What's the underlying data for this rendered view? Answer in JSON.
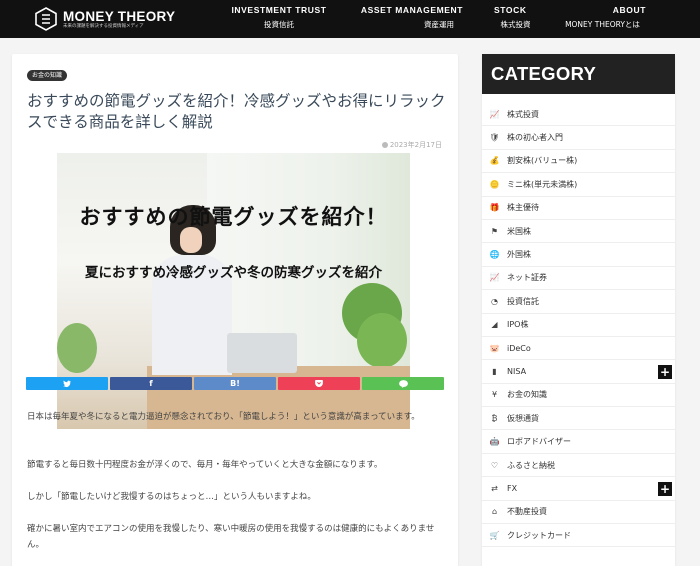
{
  "header": {
    "logo_title": "MONEY THEORY",
    "logo_subtitle": "未来の課題を解決する投資情報メディア",
    "nav": [
      {
        "en": "INVESTMENT TRUST",
        "ja": "投資信託"
      },
      {
        "en": "ASSET MANAGEMENT",
        "ja": "資産運用"
      },
      {
        "en": "STOCK",
        "ja": "株式投資"
      },
      {
        "en": "ABOUT",
        "ja": "MONEY THEORYとは"
      }
    ]
  },
  "article": {
    "category_badge": "お金の知識",
    "title": "おすすめの節電グッズを紹介！冷感グッズやお得にリラックスできる商品を詳しく解説",
    "date": "2023年2月17日",
    "hero_text_main": "おすすめの節電グッズを紹介！",
    "hero_text_sub": "夏におすすめ冷感グッズや冬の防寒グッズを紹介",
    "share": [
      {
        "label": "✓",
        "color": "#1da1f2"
      },
      {
        "label": "f",
        "color": "#3b5998"
      },
      {
        "label": "B!",
        "color": "#5d8ac9"
      },
      {
        "label": "◘",
        "color": "#ee4056"
      },
      {
        "label": "💬",
        "color": "#5ac254"
      }
    ],
    "paragraphs": [
      "日本は毎年夏や冬になると電力逼迫が懸念されており、「節電しよう！」という意識が高まっています。",
      "節電すると毎日数十円程度お金が浮くので、毎月・毎年やっていくと大きな金額になります。",
      "しかし「節電したいけど我慢するのはちょっと…」という人もいますよね。",
      "確かに暑い室内でエアコンの使用を我慢したり、寒い中暖房の使用を我慢するのは健康的にもよくありません。"
    ]
  },
  "sidebar": {
    "heading": "CATEGORY",
    "items": [
      {
        "label": "株式投資",
        "icon": "chart-line-icon",
        "glyph": "📈",
        "plus": false
      },
      {
        "label": "株の初心者入門",
        "icon": "shield-icon",
        "glyph": "🛡",
        "plus": false
      },
      {
        "label": "割安株(バリュー株)",
        "icon": "money-bag-icon",
        "glyph": "💰",
        "plus": false
      },
      {
        "label": "ミニ株(単元未満株)",
        "icon": "coins-icon",
        "glyph": "🪙",
        "plus": false
      },
      {
        "label": "株主優待",
        "icon": "gift-icon",
        "glyph": "🎁",
        "plus": false
      },
      {
        "label": "米国株",
        "icon": "flag-icon",
        "glyph": "⚑",
        "plus": false
      },
      {
        "label": "外国株",
        "icon": "globe-icon",
        "glyph": "🌐",
        "plus": false
      },
      {
        "label": "ネット証券",
        "icon": "chart-line-icon",
        "glyph": "📈",
        "plus": false
      },
      {
        "label": "投資信託",
        "icon": "pie-chart-icon",
        "glyph": "◔",
        "plus": false
      },
      {
        "label": "IPO株",
        "icon": "rising-chart-icon",
        "glyph": "◢",
        "plus": false
      },
      {
        "label": "iDeCo",
        "icon": "piggy-bank-icon",
        "glyph": "🐷",
        "plus": false
      },
      {
        "label": "NISA",
        "icon": "bar-chart-icon",
        "glyph": "▮",
        "plus": true
      },
      {
        "label": "お金の知識",
        "icon": "coin-stack-icon",
        "glyph": "¥",
        "plus": false
      },
      {
        "label": "仮想通貨",
        "icon": "bitcoin-icon",
        "glyph": "₿",
        "plus": false
      },
      {
        "label": "ロボアドバイザー",
        "icon": "robot-icon",
        "glyph": "🤖",
        "plus": false
      },
      {
        "label": "ふるさと納税",
        "icon": "hands-icon",
        "glyph": "♡",
        "plus": false
      },
      {
        "label": "FX",
        "icon": "exchange-icon",
        "glyph": "⇄",
        "plus": true
      },
      {
        "label": "不動産投資",
        "icon": "house-icon",
        "glyph": "⌂",
        "plus": false
      },
      {
        "label": "クレジットカード",
        "icon": "cart-icon",
        "glyph": "🛒",
        "plus": false
      }
    ]
  },
  "colors": {
    "header_bg": "#111111",
    "sidebar_head_bg": "#222222",
    "title_color": "#3a4a5a"
  }
}
